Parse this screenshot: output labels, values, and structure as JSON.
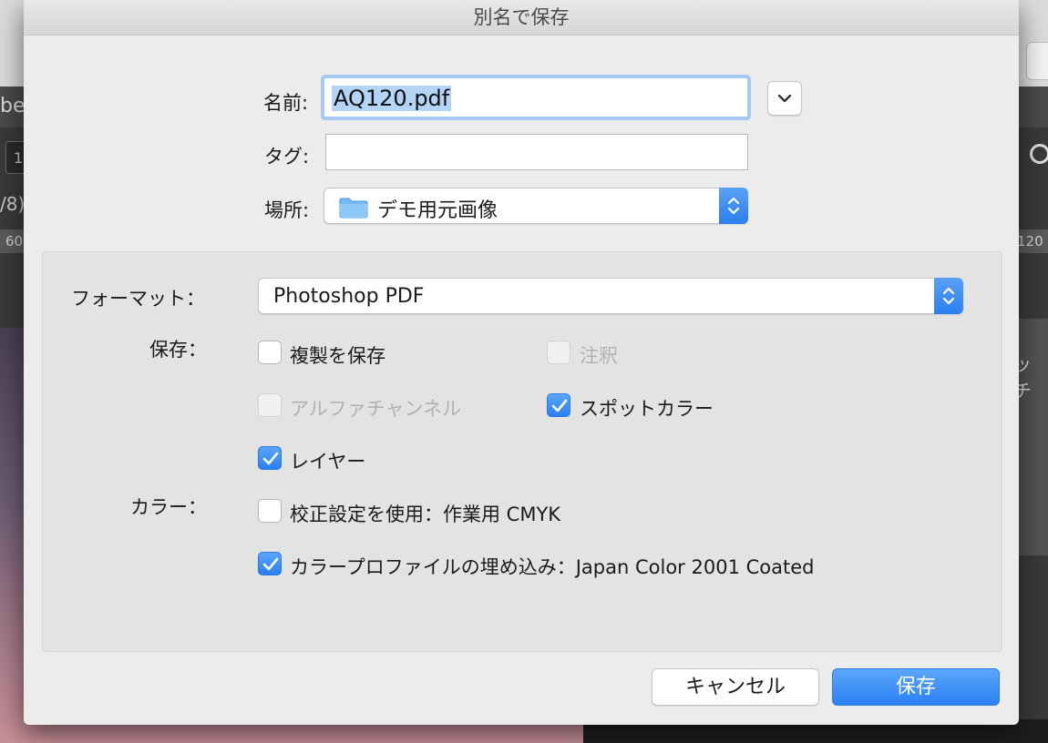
{
  "background": {
    "partial_app_text": "be",
    "partial_field_text": "1",
    "partial_info_text": "/8)",
    "ruler_left": "60",
    "ruler_right": "120",
    "side_panel_text": "ッチ"
  },
  "dialog": {
    "title": "別名で保存",
    "name_label": "名前:",
    "name_value": "AQ120.pdf",
    "tag_label": "タグ:",
    "tag_value": "",
    "location_label": "場所:",
    "location_value": "デモ用元画像",
    "location_icon": "folder-icon"
  },
  "options": {
    "format_label": "フォーマット：",
    "format_value": "Photoshop PDF",
    "save_label": "保存：",
    "color_label": "カラー：",
    "checkboxes": [
      {
        "label": "複製を保存",
        "checked": false,
        "disabled": false
      },
      {
        "label": "注釈",
        "checked": false,
        "disabled": true
      },
      {
        "label": "アルファチャンネル",
        "checked": false,
        "disabled": true
      },
      {
        "label": "スポットカラー",
        "checked": true,
        "disabled": false
      },
      {
        "label": "レイヤー",
        "checked": true,
        "disabled": false
      },
      {
        "label": "校正設定を使用：作業用 CMYK",
        "checked": false,
        "disabled": false
      },
      {
        "label": "カラープロファイルの埋め込み：Japan Color 2001 Coated",
        "checked": true,
        "disabled": false
      }
    ]
  },
  "buttons": {
    "cancel": "キャンセル",
    "save": "保存"
  },
  "colors": {
    "accent": "#2a80f2",
    "sheet_bg": "#ececec",
    "panel_bg": "#e3e3e3"
  }
}
